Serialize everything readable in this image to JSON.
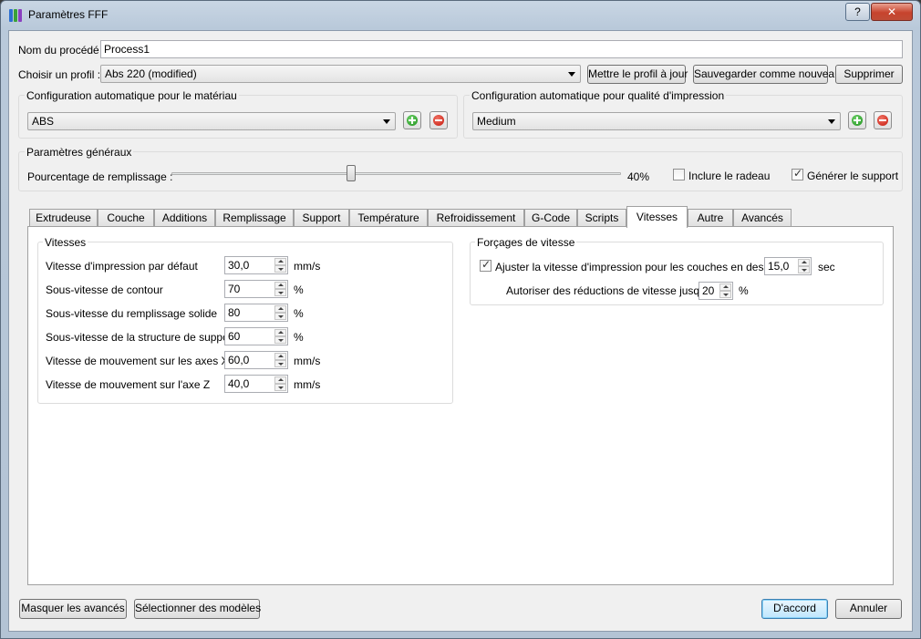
{
  "window": {
    "title": "Paramètres FFF",
    "help_label": "?",
    "close_label": "✕"
  },
  "process": {
    "name_label": "Nom du procédé :",
    "name_value": "Process1"
  },
  "profile": {
    "label": "Choisir un profil :",
    "selected": "Abs 220 (modified)",
    "update_label": "Mettre le profil à jour",
    "save_new_label": "Sauvegarder comme nouveau",
    "delete_label": "Supprimer"
  },
  "material": {
    "title": "Configuration automatique pour le matériau",
    "selected": "ABS"
  },
  "quality": {
    "title": "Configuration automatique pour qualité d'impression",
    "selected": "Medium"
  },
  "general": {
    "title": "Paramètres généraux",
    "infill_label": "Pourcentage de remplissage :",
    "infill_value_text": "40%",
    "infill_fraction": 0.4,
    "raft_label": "Inclure le radeau",
    "raft_checked": false,
    "support_label": "Générer le support",
    "support_checked": true
  },
  "tabs": [
    {
      "label": "Extrudeuse"
    },
    {
      "label": "Couche"
    },
    {
      "label": "Additions"
    },
    {
      "label": "Remplissage"
    },
    {
      "label": "Support"
    },
    {
      "label": "Température"
    },
    {
      "label": "Refroidissement"
    },
    {
      "label": "G-Code"
    },
    {
      "label": "Scripts"
    },
    {
      "label": "Vitesses"
    },
    {
      "label": "Autre"
    },
    {
      "label": "Avancés"
    }
  ],
  "active_tab": "Vitesses",
  "speeds": {
    "title": "Vitesses",
    "rows": [
      {
        "label": "Vitesse d'impression par défaut",
        "value": "30,0",
        "unit": "mm/s"
      },
      {
        "label": "Sous-vitesse de contour",
        "value": "70",
        "unit": "%"
      },
      {
        "label": "Sous-vitesse du remplissage solide",
        "value": "80",
        "unit": "%"
      },
      {
        "label": "Sous-vitesse de la structure de support",
        "value": "60",
        "unit": "%"
      },
      {
        "label": "Vitesse de mouvement sur les axes X/Y",
        "value": "60,0",
        "unit": "mm/s"
      },
      {
        "label": "Vitesse de mouvement sur l'axe Z",
        "value": "40,0",
        "unit": "mm/s"
      }
    ]
  },
  "overrides": {
    "title": "Forçages de vitesse",
    "adjust_label": "Ajuster la vitesse d'impression pour les couches en dessous",
    "adjust_checked": true,
    "adjust_value": "15,0",
    "adjust_unit": "sec",
    "allow_label": "Autoriser des réductions de vitesse jusqu'à",
    "allow_value": "20",
    "allow_unit": "%"
  },
  "footer": {
    "hide_advanced_label": "Masquer les avancés",
    "select_models_label": "Sélectionner des modèles",
    "ok_label": "D'accord",
    "cancel_label": "Annuler"
  }
}
